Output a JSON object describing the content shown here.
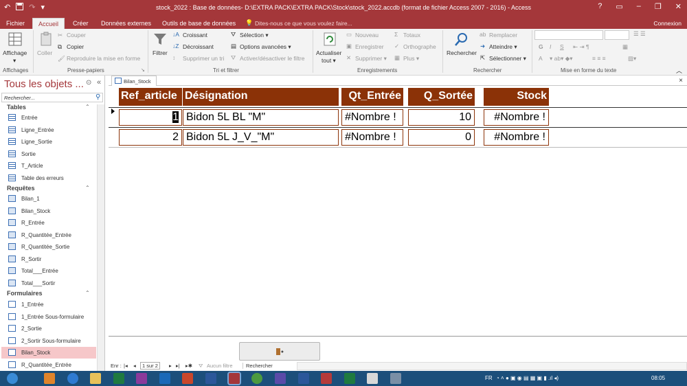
{
  "window": {
    "title": "stock_2022 : Base de données- D:\\EXTRA PACK\\EXTRA PACK\\Stock\\stock_2022.accdb (format de fichier Access 2007 - 2016) - Access",
    "help": "?",
    "minimize": "–",
    "restore": "❐",
    "close": "✕"
  },
  "tabs": [
    "Fichier",
    "Accueil",
    "Créer",
    "Données externes",
    "Outils de base de données"
  ],
  "tellme": "Dites-nous ce que vous voulez faire...",
  "connexion": "Connexion",
  "ribbon": {
    "affichage": "Affichage",
    "coller": "Coller",
    "couper": "Couper",
    "copier": "Copier",
    "reproduire": "Reproduire la mise en forme",
    "filtrer": "Filtrer",
    "croissant": "Croissant",
    "decroissant": "Décroissant",
    "supprimer_tri": "Supprimer un tri",
    "selection": "Sélection",
    "options": "Options avancées",
    "activer": "Activer/désactiver le filtre",
    "actualiser1": "Actualiser",
    "actualiser2": "tout",
    "nouveau": "Nouveau",
    "enregistrer": "Enregistrer",
    "supprimer": "Supprimer",
    "totaux": "Totaux",
    "orthographe": "Orthographe",
    "plus": "Plus",
    "rechercher": "Rechercher",
    "remplacer": "Remplacer",
    "atteindre": "Atteindre",
    "selectionner": "Sélectionner",
    "fmt": {
      "g": "G",
      "i": "I",
      "s": "S",
      "a": "A"
    },
    "groups": {
      "affichages": "Affichages",
      "presse": "Presse-papiers",
      "tri": "Tri et filtrer",
      "enreg": "Enregistrements",
      "rech": "Rechercher",
      "mef": "Mise en forme du texte"
    }
  },
  "nav": {
    "title": "Tous les objets ...",
    "search_placeholder": "Rechercher...",
    "sections": {
      "tables": "Tables",
      "requetes": "Requêtes",
      "formulaires": "Formulaires"
    },
    "tables": [
      "Entrée",
      "Ligne_Entrée",
      "Ligne_Sortie",
      "Sortie",
      "T_Article",
      "Table des erreurs"
    ],
    "requetes": [
      "Bilan_1",
      "Bilan_Stock",
      "R_Entrée",
      "R_Quantitée_Entrée",
      "R_Quantitée_Sortie",
      "R_Sortir",
      "Total___Entrée",
      "Total___Sortir"
    ],
    "formulaires": [
      "1_Entrée",
      "1_Entrée Sous-formulaire",
      "2_Sortie",
      "2_Sortir Sous-formulaire",
      "Bilan_Stock",
      "R_Quantitée_Entrée"
    ]
  },
  "doc": {
    "tab": "Bilan_Stock",
    "close": "×"
  },
  "form": {
    "headers": {
      "ref": "Ref_article",
      "des": "Désignation",
      "qe": "Qt_Entrée",
      "qs": "Q_Sortée",
      "stock": "Stock"
    },
    "rows": [
      {
        "ref": "1",
        "des": "Bidon 5L BL \"M\"",
        "qe": "#Nombre !",
        "qs": "10",
        "stock": "#Nombre !"
      },
      {
        "ref": "2",
        "des": "Bidon 5L J_V_\"M\"",
        "qe": "#Nombre !",
        "qs": "0",
        "stock": "#Nombre !"
      }
    ]
  },
  "recnav": {
    "label": "Enr :",
    "pos": "1 sur 2",
    "filter": "Aucun filtre",
    "search": "Rechercher"
  },
  "taskbar": {
    "lang": "FR",
    "time": "08:05"
  },
  "colors": {
    "accent": "#a4373a",
    "header": "#8b3207",
    "selected_nav": "#f6c7c9"
  }
}
